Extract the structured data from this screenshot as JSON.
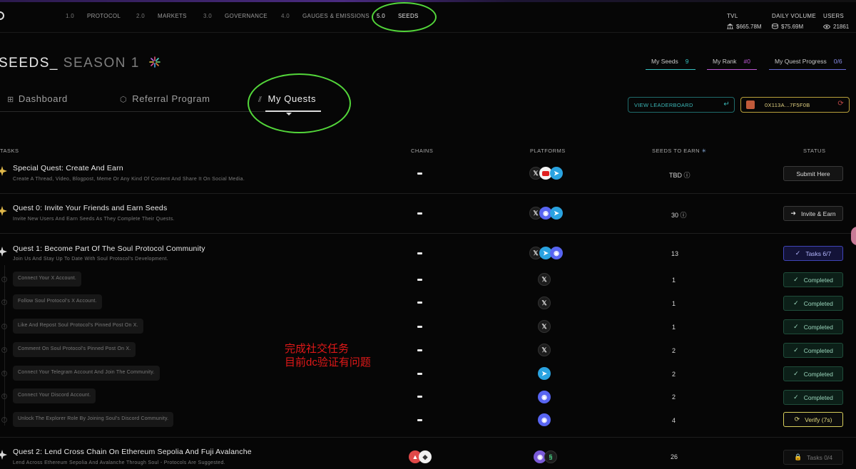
{
  "nav": [
    {
      "num": "1.0",
      "label": "PROTOCOL"
    },
    {
      "num": "2.0",
      "label": "MARKETS"
    },
    {
      "num": "3.0",
      "label": "GOVERNANCE"
    },
    {
      "num": "4.0",
      "label": "GAUGES & EMISSIONS"
    },
    {
      "num": "5.0",
      "label": "SEEDS"
    }
  ],
  "stats": [
    {
      "label": "TVL",
      "value": "$665.78M",
      "icon": "bank-icon"
    },
    {
      "label": "DAILY VOLUME",
      "value": "$75.69M",
      "icon": "none"
    },
    {
      "label": "USERS",
      "value": "21861",
      "icon": "eye-icon"
    }
  ],
  "page": {
    "title": "SEEDS_",
    "season": "SEASON 1"
  },
  "pills": [
    {
      "label": "My Seeds",
      "value": "9",
      "color": "#37c2c2"
    },
    {
      "label": "My Rank",
      "value": "#0",
      "color": "#c05ad8"
    },
    {
      "label": "My Quest Progress",
      "value": "0/6",
      "color": "#6a6dd8"
    }
  ],
  "tabs": [
    {
      "label": "Dashboard",
      "icon": "grid-icon"
    },
    {
      "label": "Referral Program",
      "icon": "cube-icon"
    },
    {
      "label": "My Quests",
      "icon": "slashes-icon"
    }
  ],
  "buttons": {
    "leaderboard": "VIEW LEADERBOARD",
    "wallet": "0X113A...7F5F0B"
  },
  "headers": {
    "tasks": "TASKS",
    "chains": "CHAINS",
    "platforms": "PLATFORMS",
    "seeds": "SEEDS TO EARN",
    "status": "STATUS"
  },
  "quests": [
    {
      "title": "Special Quest: Create And Earn",
      "desc": "Create A Thread, Video, Blogpost, Meme Or Any Kind Of Content And Share It On Social Media.",
      "seeds": "TBD",
      "status": "Submit Here"
    },
    {
      "title": "Quest 0: Invite Your Friends and Earn Seeds",
      "desc": "Invite New Users And Earn Seeds As They Complete Their Quests.",
      "seeds": "30",
      "status": "Invite & Earn"
    },
    {
      "title": "Quest 1: Become Part Of The Soul Protocol Community",
      "desc": "Join Us And Stay Up To Date With Soul Protocol's Development.",
      "seeds": "13",
      "status": "Tasks 6/7"
    },
    {
      "title": "Quest 2: Lend Cross Chain On Ethereum Sepolia And Fuji Avalanche",
      "desc": "Lend Across Ethereum Sepolia And Avalanche Through Soul - Protocols Are Suggested.",
      "seeds": "26",
      "status": "Tasks 0/4"
    }
  ],
  "subtasks": [
    {
      "label": "Connect Your X Account.",
      "seeds": "1",
      "status": "Completed",
      "platform": "x"
    },
    {
      "label": "Follow Soul Protocol's X Account.",
      "seeds": "1",
      "status": "Completed",
      "platform": "x"
    },
    {
      "label": "Like And Repost Soul Protocol's Pinned Post On X.",
      "seeds": "1",
      "status": "Completed",
      "platform": "x"
    },
    {
      "label": "Comment On Soul Protocol's Pinned Post On X.",
      "seeds": "2",
      "status": "Completed",
      "platform": "x"
    },
    {
      "label": "Connect Your Telegram Account And Join The Community.",
      "seeds": "2",
      "status": "Completed",
      "platform": "telegram"
    },
    {
      "label": "Connect Your Discord Account.",
      "seeds": "2",
      "status": "Completed",
      "platform": "discord"
    },
    {
      "label": "Unlock The Explorer Role By Joining Soul's Discord Community.",
      "seeds": "4",
      "status": "Verify (7s)",
      "platform": "discord"
    }
  ],
  "annotation": {
    "line1": "完成社交任务",
    "line2": "目前dc验证有问题"
  },
  "colors": {
    "accent_green": "#53d63a",
    "completed_bg": "#0c1f18",
    "tasks_border": "#4045b8",
    "verify_border": "#d8cf5c",
    "note_red": "#e01818"
  }
}
